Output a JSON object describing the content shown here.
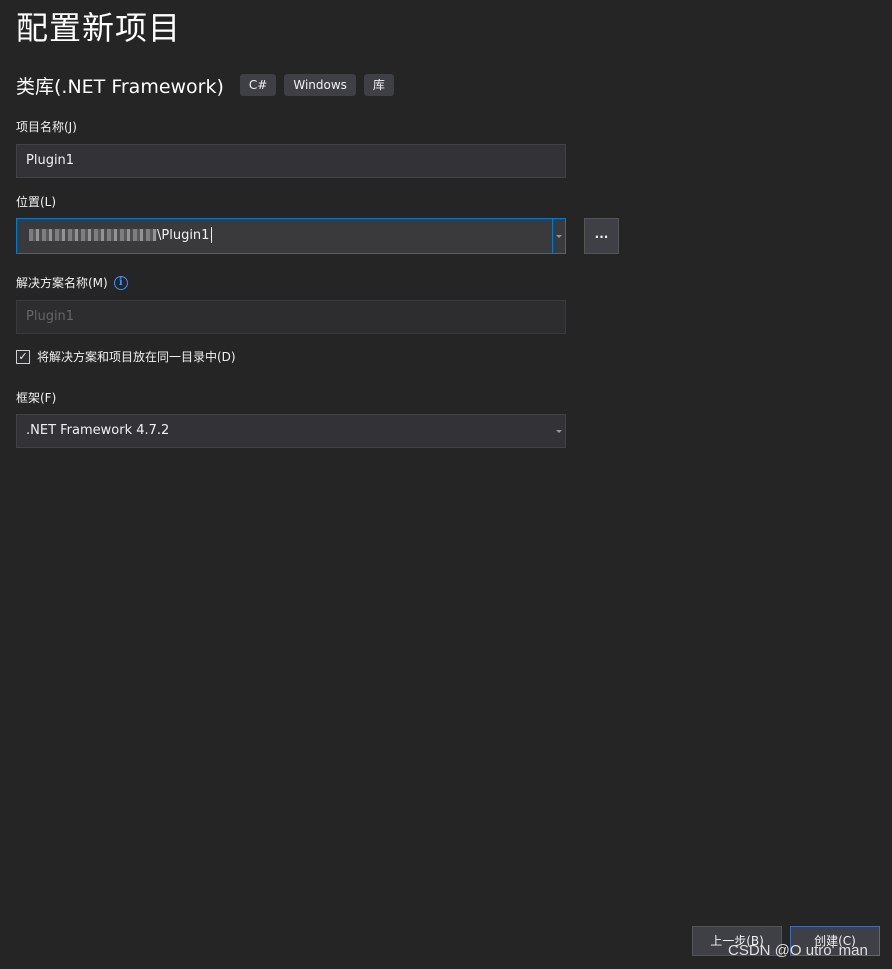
{
  "page": {
    "title": "配置新项目",
    "template_name": "类库(.NET Framework)",
    "tags": [
      "C#",
      "Windows",
      "库"
    ]
  },
  "project_name": {
    "label": "项目名称(J)",
    "value": "Plugin1"
  },
  "location": {
    "label": "位置(L)",
    "value_suffix": "\\Plugin1",
    "browse_label": "..."
  },
  "solution_name": {
    "label": "解决方案名称(M)",
    "value": "Plugin1",
    "info_icon": "i"
  },
  "same_dir": {
    "label": "将解决方案和项目放在同一目录中(D)",
    "checked": true,
    "check_glyph": "✓"
  },
  "framework": {
    "label": "框架(F)",
    "value": ".NET Framework 4.7.2"
  },
  "footer": {
    "back_label": "上一步(B)",
    "create_label": "创建(C)"
  },
  "watermark": "CSDN @O utro' man",
  "colors": {
    "background": "#252526",
    "accent": "#007acc",
    "info": "#3794ff"
  }
}
